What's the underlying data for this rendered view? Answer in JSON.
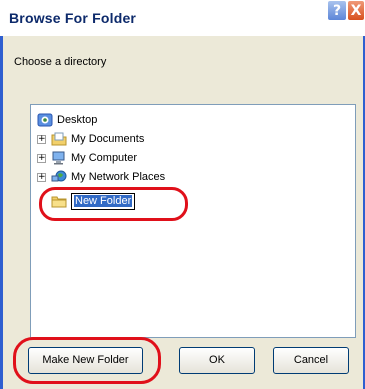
{
  "window": {
    "title": "Browse For Folder",
    "help_glyph": "?",
    "close_glyph": "X"
  },
  "prompt": "Choose a directory",
  "tree": {
    "root": {
      "label": "Desktop",
      "icon": "desktop-icon"
    },
    "items": [
      {
        "label": "My Documents",
        "icon": "documents-folder-icon",
        "expander": "+"
      },
      {
        "label": "My Computer",
        "icon": "computer-icon",
        "expander": "+"
      },
      {
        "label": "My Network Places",
        "icon": "network-places-icon",
        "expander": "+"
      }
    ],
    "new_folder": {
      "value": "New Folder",
      "icon": "folder-icon"
    }
  },
  "buttons": {
    "make_new_folder": "Make New Folder",
    "ok": "OK",
    "cancel": "Cancel"
  },
  "colors": {
    "annotation": "#e0101a",
    "title": "#0d2a6b",
    "selection": "#316ac5",
    "frame": "#2f5fd0"
  }
}
